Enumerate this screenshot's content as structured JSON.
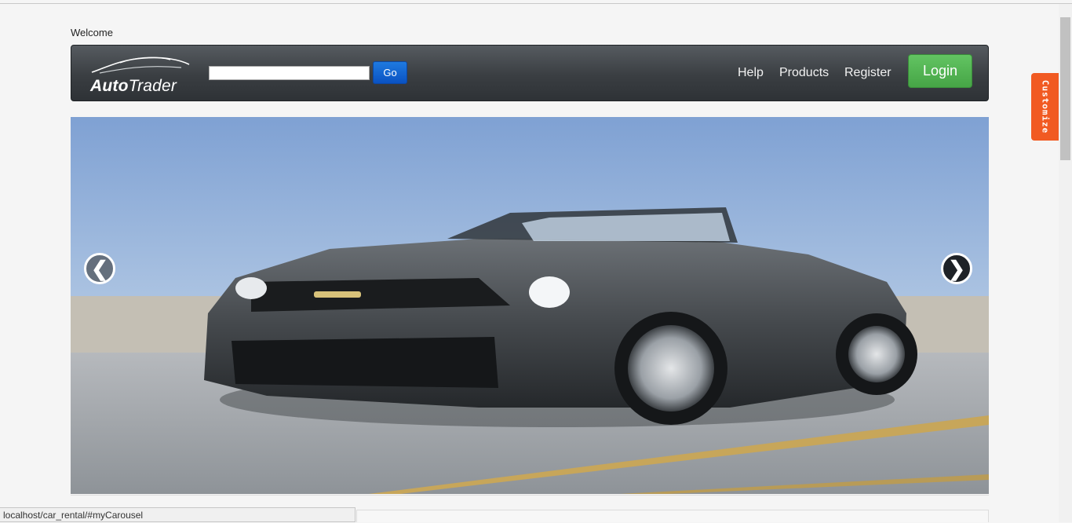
{
  "page": {
    "welcome_text": "Welcome"
  },
  "navbar": {
    "brand_part1": "Auto",
    "brand_part2": "Trader",
    "search_placeholder": "",
    "search_value": "",
    "go_label": "Go",
    "links": [
      "Help",
      "Products",
      "Register"
    ],
    "login_label": "Login"
  },
  "carousel": {
    "prev_label": "❮",
    "next_label": "❯",
    "image_alt": "Gray convertible sports car"
  },
  "status_bar": {
    "url": "localhost/car_rental/#myCarousel"
  },
  "side_tab": {
    "label": "Customize",
    "color": "#f15a22"
  },
  "colors": {
    "navbar_dark": "#3a3e42",
    "go_button": "#0a52c2",
    "login_button": "#46a546"
  }
}
